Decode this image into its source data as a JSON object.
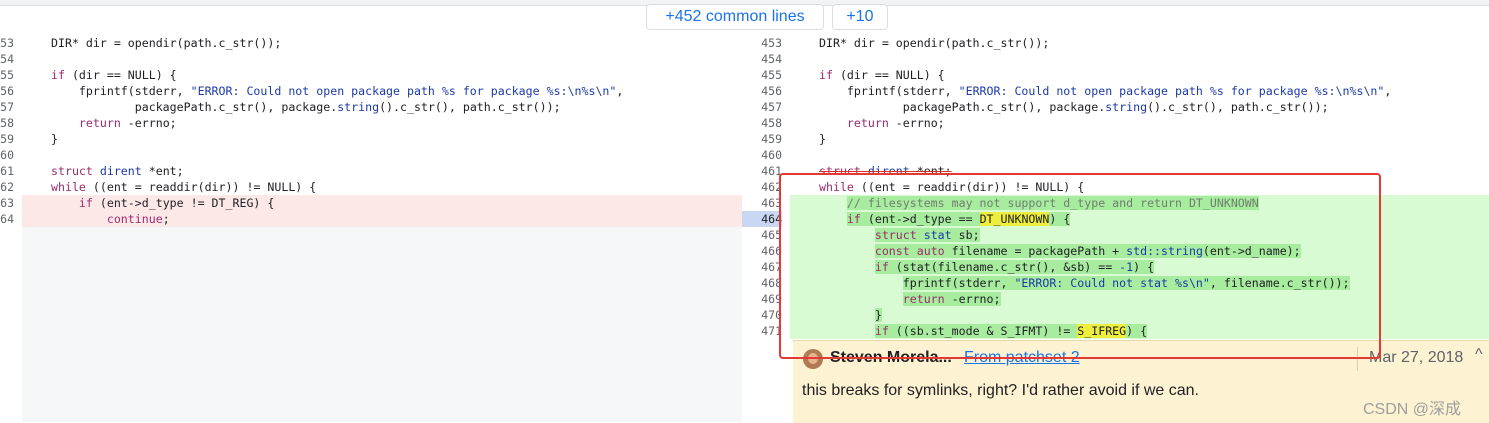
{
  "expanders": {
    "common": "+452 common lines",
    "more": "+10"
  },
  "left": {
    "lines": [
      {
        "n": "53"
      },
      {
        "n": "54"
      },
      {
        "n": "55"
      },
      {
        "n": "56"
      },
      {
        "n": "57"
      },
      {
        "n": "58"
      },
      {
        "n": "59"
      },
      {
        "n": "60"
      },
      {
        "n": "61"
      },
      {
        "n": "62"
      },
      {
        "n": "63"
      },
      {
        "n": "64"
      }
    ]
  },
  "right": {
    "lines": [
      {
        "n": "453"
      },
      {
        "n": "454"
      },
      {
        "n": "455"
      },
      {
        "n": "456"
      },
      {
        "n": "457"
      },
      {
        "n": "458"
      },
      {
        "n": "459"
      },
      {
        "n": "460"
      },
      {
        "n": "461"
      },
      {
        "n": "462"
      },
      {
        "n": "463"
      },
      {
        "n": "464"
      },
      {
        "n": "465"
      },
      {
        "n": "466"
      },
      {
        "n": "467"
      },
      {
        "n": "468"
      },
      {
        "n": "469"
      },
      {
        "n": "470"
      },
      {
        "n": "471"
      }
    ]
  },
  "t": {
    "dir_decl": "DIR* dir = opendir(path.c_str());",
    "if": "if",
    "dir_null": " (dir == NULL) {",
    "fprintf": "fprintf(stderr, ",
    "err_open": "\"ERROR: Could not open package path %s for package %s:\\n%s\\n\"",
    "comma": ",",
    "pkgpath_a": "packagePath.c_str(), package.",
    "string": "string",
    "pkgpath_b": "().c_str(), path.c_str());",
    "return": "return",
    "errno": " -errno;",
    "close": "}",
    "struct": "struct",
    "dirent": " dirent",
    "ent": " *ent;",
    "while": "while",
    "readdir": " ((ent = readdir(dir)) != NULL) {",
    "dtype_reg": " (ent->d_type != DT_REG) {",
    "continue": "continue",
    "semi": ";",
    "comment": "// filesystems may not support d_type and return DT_UNKNOWN",
    "dtype_open": " (ent->d_type == ",
    "dt_unknown": "DT_UNKNOWN",
    "paren_brace": ") {",
    "stat": " stat",
    "sb": " sb;",
    "const": "const",
    "auto": " auto",
    "filename": " filename = packagePath + ",
    "std_string": "std::string",
    "entname": "(ent->d_name);",
    "stat_call": " (stat(filename.c_str(), &sb) == ",
    "minus1": "-1",
    "brace": ") {",
    "err_stat": "\"ERROR: Could not stat %s\\n\"",
    "fname_cstr": ", filename.c_str());",
    "sbmode": " ((sb.st_mode & S_IFMT) != ",
    "s_ifreg": "S_IFREG"
  },
  "comment": {
    "author": "Steven Morela...",
    "link": "From patchset 2",
    "date": "Mar 27, 2018",
    "chevron": "^",
    "text": "this breaks for symlinks, right? I'd rather avoid if we can."
  },
  "watermark": "CSDN @深成",
  "colors": {
    "deleted_bg": "#fde8e8",
    "added_bg": "#d8fbd4",
    "added_highlight": "#a8ec9f",
    "annotation_box": "#e53935",
    "comment_bg": "#fdf3d3",
    "link": "#1a73e8"
  },
  "icons": {
    "avatar": "avatar-photo",
    "chevron": "chevron-up-icon"
  }
}
